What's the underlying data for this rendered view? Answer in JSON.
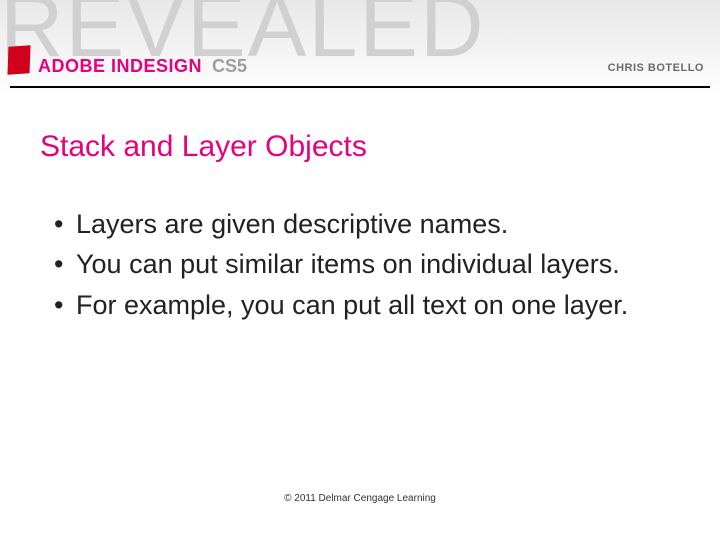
{
  "banner": {
    "background_word": "REVEALED",
    "product": "ADOBE INDESIGN",
    "version": "CS5",
    "author": "CHRIS BOTELLO"
  },
  "slide": {
    "title": "Stack and Layer Objects",
    "bullets": [
      "Layers are given descriptive names.",
      "You can put similar items on individual layers.",
      "For example, you can put all text on one layer."
    ]
  },
  "footer": {
    "copyright": "© 2011 Delmar Cengage Learning"
  }
}
